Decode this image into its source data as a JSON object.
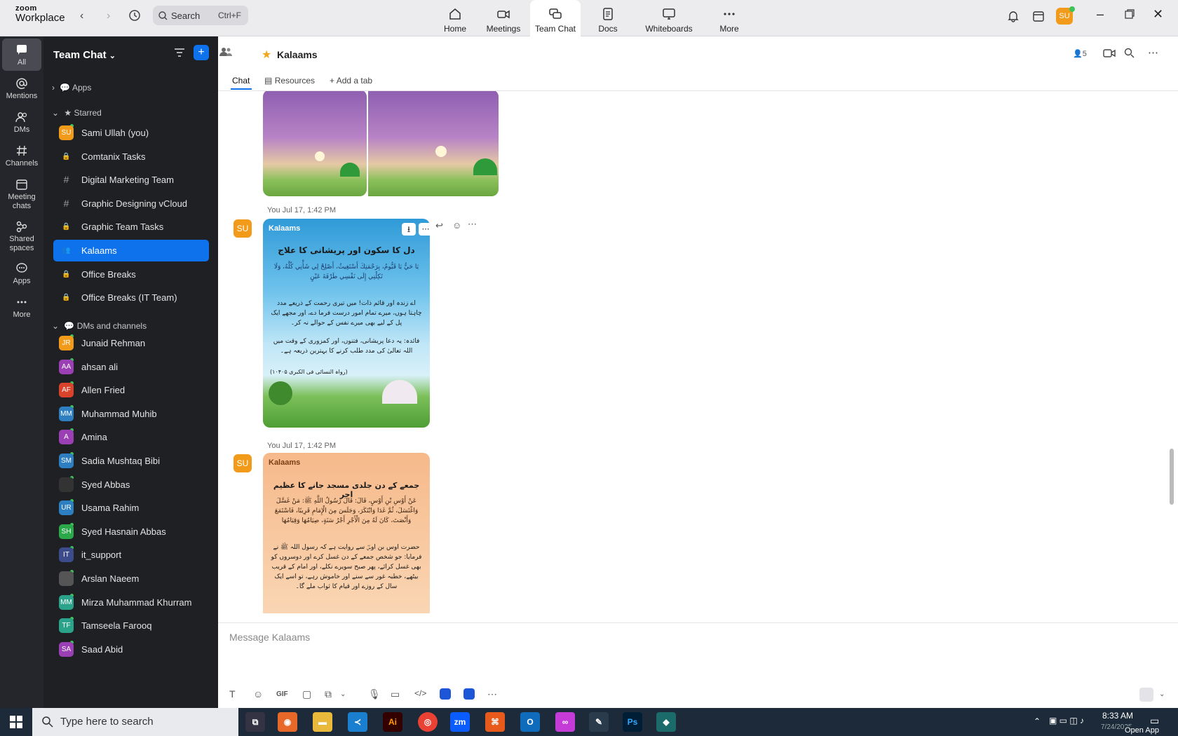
{
  "app": {
    "brand_top": "zoom",
    "brand_bottom": "Workplace"
  },
  "search": {
    "placeholder": "Search",
    "shortcut": "Ctrl+F"
  },
  "tabs": [
    {
      "label": "Home"
    },
    {
      "label": "Meetings"
    },
    {
      "label": "Team Chat"
    },
    {
      "label": "Docs"
    },
    {
      "label": "Whiteboards"
    },
    {
      "label": "More"
    }
  ],
  "user_initials": "SU",
  "rail": [
    {
      "label": "All"
    },
    {
      "label": "Mentions"
    },
    {
      "label": "DMs"
    },
    {
      "label": "Channels"
    },
    {
      "label": "Meeting chats"
    },
    {
      "label": "Shared spaces"
    },
    {
      "label": "Apps"
    },
    {
      "label": "More"
    }
  ],
  "sidebar": {
    "title": "Team Chat",
    "apps_label": "Apps",
    "starred_label": "Starred",
    "starred": [
      {
        "label": "Sami Ullah (you)",
        "initials": "SU",
        "color": "#f29b1a"
      },
      {
        "label": "Comtanix Tasks",
        "icon": "lock"
      },
      {
        "label": "Digital Marketing Team",
        "icon": "#"
      },
      {
        "label": "Graphic Designing vCloud",
        "icon": "#"
      },
      {
        "label": "Graphic Team Tasks",
        "icon": "lock"
      },
      {
        "label": "Kalaams",
        "icon": "group"
      },
      {
        "label": "Office Breaks",
        "icon": "lock"
      },
      {
        "label": "Office Breaks (IT Team)",
        "icon": "lock"
      }
    ],
    "dms_label": "DMs and channels",
    "dms": [
      {
        "label": "Junaid Rehman",
        "initials": "JR",
        "color": "#f29b1a"
      },
      {
        "label": "ahsan ali",
        "initials": "AA",
        "color": "#9b3fb5"
      },
      {
        "label": "Allen Fried",
        "initials": "AF",
        "color": "#d9432c"
      },
      {
        "label": "Muhammad Muhib",
        "initials": "MM",
        "color": "#2d7fc1"
      },
      {
        "label": "Amina",
        "initials": "A",
        "color": "#9b3fb5"
      },
      {
        "label": "Sadia Mushtaq Bibi",
        "initials": "SM",
        "color": "#2d7fc1"
      },
      {
        "label": "Syed Abbas",
        "initials": "",
        "color": "#333333"
      },
      {
        "label": "Usama Rahim",
        "initials": "UR",
        "color": "#2d7fc1"
      },
      {
        "label": "Syed Hasnain Abbas",
        "initials": "SH",
        "color": "#2aa84a"
      },
      {
        "label": "it_support",
        "initials": "IT",
        "color": "#3b4b8c"
      },
      {
        "label": "Arslan Naeem",
        "initials": "",
        "color": "#555555"
      },
      {
        "label": "Mirza Muhammad Khurram",
        "initials": "MM",
        "color": "#2aa38a"
      },
      {
        "label": "Tamseela Farooq",
        "initials": "TF",
        "color": "#2aa38a"
      },
      {
        "label": "Saad Abid",
        "initials": "SA",
        "color": "#9b3fb5"
      }
    ]
  },
  "channel": {
    "name": "Kalaams",
    "member_count": "5",
    "tabs": {
      "chat": "Chat",
      "resources": "Resources",
      "add": "Add a tab"
    }
  },
  "messages": [
    {
      "timestamp": "You Jul 17, 1:42 PM",
      "card_logo": "Kalaams",
      "card_title": "دل کا سکون اور پریشانی کا علاج",
      "arabic": "يَا حَيُّ يَا قَيُّومُ، بِرَحْمَتِكَ أَسْتَغِيثُ، أَصْلِحْ لِي شَأْنِي كُلَّهُ، وَلَا تَكِلْنِي إِلَى نَفْسِي طَرْفَةَ عَيْنٍ",
      "urdu": "اے زندہ اور قائم ذات! میں تیری رحمت کے ذریعے مدد چاہتا ہوں، میرے تمام امور درست فرما دے، اور مجھے ایک پل کے لیے بھی میرے نفس کے حوالے نہ کر۔",
      "note": "فائدہ: یہ دعا پریشانی، فتنوں، اور کمزوری کے وقت میں اللہ تعالیٰ کی مدد طلب کرنے کا بہترین ذریعہ ہے۔",
      "ref": "(رواہ النسائی فی الکبری ۱۰۴۰۵)"
    },
    {
      "timestamp": "You Jul 17, 1:42 PM",
      "card_logo": "Kalaams",
      "card_title": "جمعے کے دن جلدی مسجد جانے کا عظیم اجر",
      "arabic": "عَنْ أَوْسِ بْنِ أَوْسٍ، قَالَ: قَالَ رَسُولُ اللَّهِ ﷺ: مَنْ غَسَّلَ وَاغْتَسَلَ، ثُمَّ غَدَا وَابْتَكَرَ، وَجَلَسَ مِنَ الْإِمَامِ قَرِيبًا، فَاسْتَمَعَ وَأَنْصَتَ، كَانَ لَهُ مِنَ الْأَجْرِ أَجْرُ سَنَةٍ، صِيَامُهَا وَقِيَامُهَا",
      "urdu": "حضرت اوس بن اوسؓ سے روایت ہے کہ رسول اللہ ﷺ نے فرمایا: جو شخص جمعے کے دن غسل کرے اور دوسروں کو بھی غسل کرائے، پھر صبح سویرے نکلے، اور امام کے قریب بیٹھے، خطبہ غور سے سنے اور خاموش رہے، تو اسے ایک سال کے روزے اور قیام کا ثواب ملے گا۔"
    }
  ],
  "composer": {
    "placeholder": "Message Kalaams",
    "gif": "GIF"
  },
  "taskbar": {
    "search_placeholder": "Type here to search",
    "time": "8:33 AM",
    "date": "7/24/2025",
    "open_app": "Open App"
  }
}
